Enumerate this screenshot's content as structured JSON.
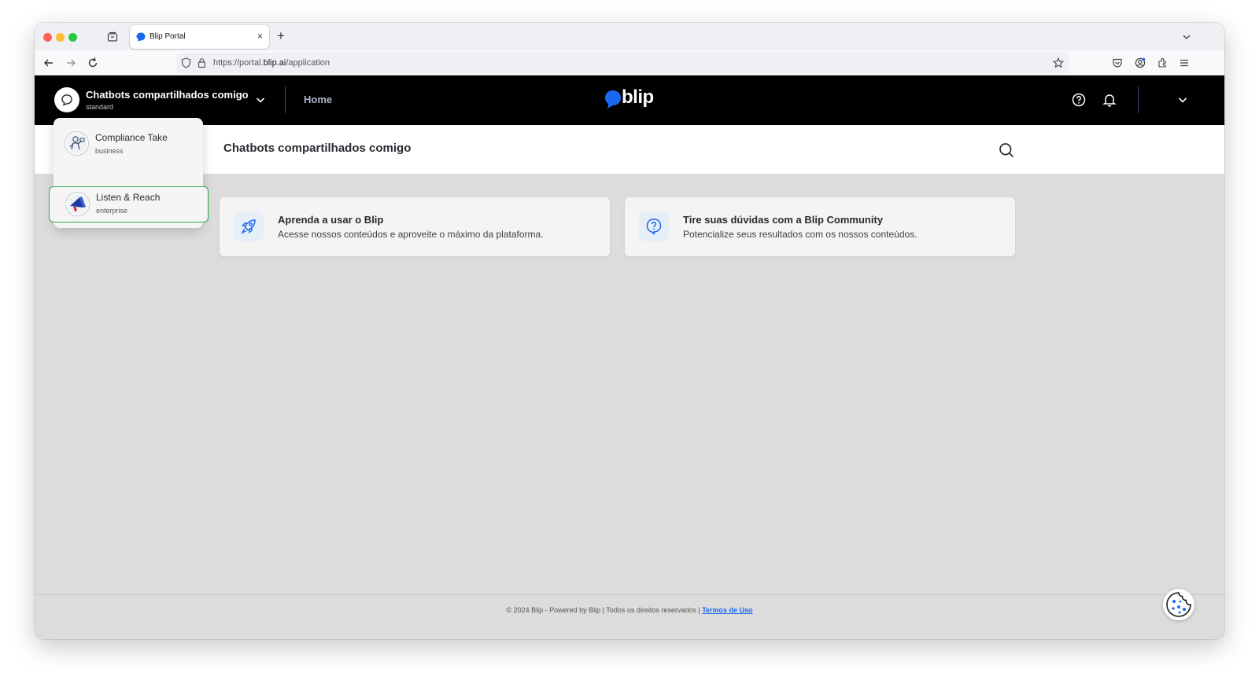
{
  "browser": {
    "tab_title": "Blip Portal",
    "tab_close": "×",
    "new_tab": "+",
    "url_prefix": "https://portal.",
    "url_domain": "blip.ai",
    "url_path": "/application"
  },
  "header": {
    "bot_name": "Chatbots compartilhados comigo",
    "bot_plan": "standard",
    "home_link": "Home",
    "logo_text": "blip"
  },
  "page": {
    "title": "Chatbots compartilhados comigo"
  },
  "cards": [
    {
      "title": "Aprenda a usar o Blip",
      "description": "Acesse nossos conteúdos e aproveite o máximo da plataforma."
    },
    {
      "title": "Tire suas dúvidas com a Blip Community",
      "description": "Potencialize seus resultados com os nossos conteúdos."
    }
  ],
  "dropdown": {
    "items": [
      {
        "name": "Compliance Take",
        "plan": "business"
      },
      {
        "name": "Listen & Reach",
        "plan": "enterprise"
      }
    ]
  },
  "footer": {
    "text": "© 2024 Blip - Powered by Blip | Todos os direitos reservados | ",
    "link": "Termos de Uso"
  },
  "colors": {
    "brand_blue": "#1968f0",
    "header_bg": "#000000",
    "selected_border": "#2fa84f"
  }
}
